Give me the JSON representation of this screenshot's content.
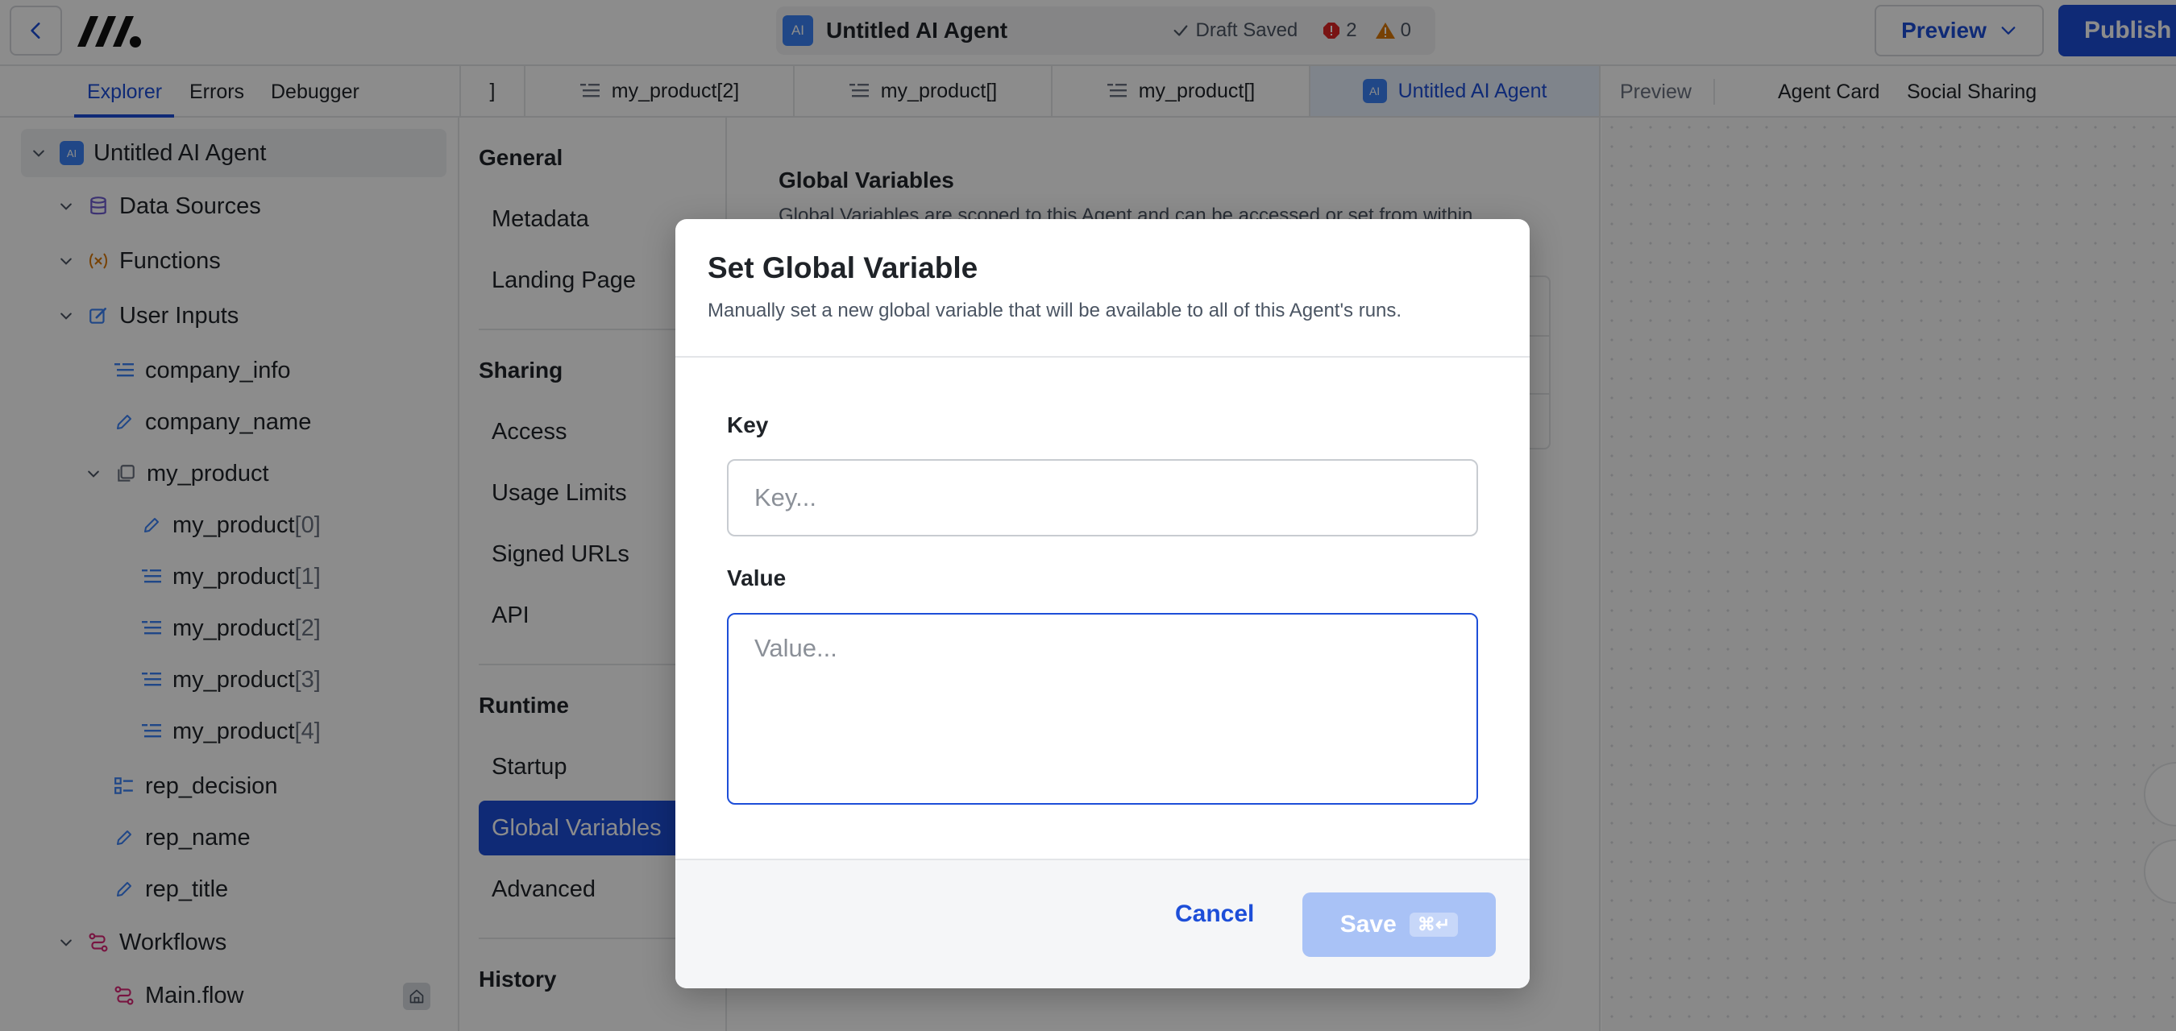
{
  "topbar": {
    "agent_title": "Untitled AI Agent",
    "ai_badge": "AI",
    "draft_status": "Draft Saved",
    "error_count": "2",
    "warning_count": "0",
    "preview_label": "Preview",
    "publish_label": "Publish"
  },
  "left_tabs": [
    "Explorer",
    "Errors",
    "Debugger"
  ],
  "file_tabs": [
    {
      "label": "]",
      "icon": "text-lines-icon"
    },
    {
      "label": "my_product[2]",
      "icon": "text-lines-icon"
    },
    {
      "label": "my_product[]",
      "icon": "text-lines-icon"
    },
    {
      "label": "my_product[]",
      "icon": "text-lines-icon"
    },
    {
      "label": "Untitled AI Agent",
      "icon": "ai-badge-icon"
    }
  ],
  "right_tabs": [
    "Preview",
    "Agent Card",
    "Social Sharing"
  ],
  "tree": {
    "root": "Untitled AI Agent",
    "data_sources": "Data Sources",
    "functions": "Functions",
    "user_inputs": "User Inputs",
    "company_info": "company_info",
    "company_name": "company_name",
    "my_product": "my_product",
    "mp_name": "my_product",
    "mp_idx": [
      "[0]",
      "[1]",
      "[2]",
      "[3]",
      "[4]"
    ],
    "rep_decision": "rep_decision",
    "rep_name": "rep_name",
    "rep_title": "rep_title",
    "workflows": "Workflows",
    "main_flow": "Main.flow"
  },
  "settings_nav": {
    "general": "General",
    "metadata": "Metadata",
    "landing_page": "Landing Page",
    "sharing": "Sharing",
    "access": "Access",
    "usage_limits": "Usage Limits",
    "signed_urls": "Signed URLs",
    "api": "API",
    "runtime": "Runtime",
    "startup": "Startup",
    "global_variables": "Global Variables",
    "advanced": "Advanced",
    "history": "History"
  },
  "main": {
    "title": "Global Variables",
    "description": "Global Variables are scoped to this Agent and can be accessed or set from within"
  },
  "modal": {
    "title": "Set Global Variable",
    "subtitle": "Manually set a new global variable that will be available to all of this Agent's runs.",
    "key_label": "Key",
    "key_placeholder": "Key...",
    "key_value": "",
    "value_label": "Value",
    "value_placeholder": "Value...",
    "value_value": "",
    "cancel_label": "Cancel",
    "save_label": "Save",
    "save_shortcut": "⌘↵"
  },
  "colors": {
    "accent": "#1d4ed8",
    "overlay": "rgba(0,0,0,0.45)",
    "error": "#dc2626",
    "warning": "#d97706"
  }
}
